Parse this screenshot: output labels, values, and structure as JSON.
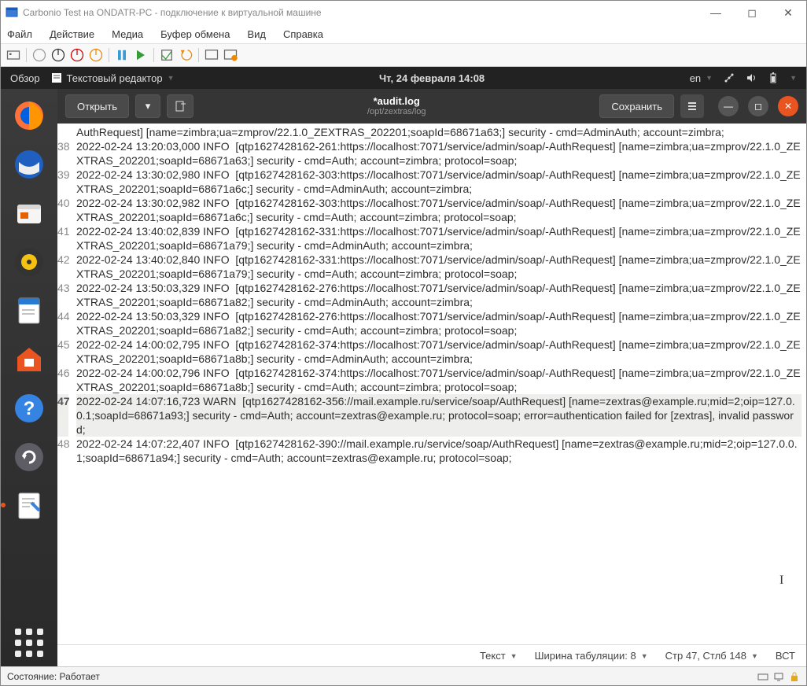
{
  "host": {
    "title": "Carbonio Test на ONDATR-PC - подключение к виртуальной машине",
    "menus": [
      "Файл",
      "Действие",
      "Медиа",
      "Буфер обмена",
      "Вид",
      "Справка"
    ],
    "status_left": "Состояние: Работает"
  },
  "guest_panel": {
    "activities": "Обзор",
    "app_indicator": "Текстовый редактор",
    "datetime": "Чт, 24 февраля  14:08",
    "lang": "en"
  },
  "editor": {
    "open_btn": "Открыть",
    "save_btn": "Сохранить",
    "filename": "*audit.log",
    "filepath": "/opt/zextras/log"
  },
  "statusbar": {
    "syntax": "Текст",
    "tab_label": "Ширина табуляции: 8",
    "cursor": "Стр 47, Стлб 148",
    "insert": "ВСТ"
  },
  "log": {
    "pre_lines": [
      "AuthRequest] [name=zimbra;ua=zmprov/22.1.0_ZEXTRAS_202201;soapId=68671a63;] security - cmd=AdminAuth; account=zimbra;"
    ],
    "entries": [
      {
        "n": 38,
        "hl": false,
        "t": "2022-02-24 13:20:03,000 INFO  [qtp1627428162-261:https://localhost:7071/service/admin/soap/-AuthRequest] [name=zimbra;ua=zmprov/22.1.0_ZEXTRAS_202201;soapId=68671a63;] security - cmd=Auth; account=zimbra; protocol=soap;"
      },
      {
        "n": 39,
        "hl": false,
        "t": "2022-02-24 13:30:02,980 INFO  [qtp1627428162-303:https://localhost:7071/service/admin/soap/-AuthRequest] [name=zimbra;ua=zmprov/22.1.0_ZEXTRAS_202201;soapId=68671a6c;] security - cmd=AdminAuth; account=zimbra;"
      },
      {
        "n": 40,
        "hl": false,
        "t": "2022-02-24 13:30:02,982 INFO  [qtp1627428162-303:https://localhost:7071/service/admin/soap/-AuthRequest] [name=zimbra;ua=zmprov/22.1.0_ZEXTRAS_202201;soapId=68671a6c;] security - cmd=Auth; account=zimbra; protocol=soap;"
      },
      {
        "n": 41,
        "hl": false,
        "t": "2022-02-24 13:40:02,839 INFO  [qtp1627428162-331:https://localhost:7071/service/admin/soap/-AuthRequest] [name=zimbra;ua=zmprov/22.1.0_ZEXTRAS_202201;soapId=68671a79;] security - cmd=AdminAuth; account=zimbra;"
      },
      {
        "n": 42,
        "hl": false,
        "t": "2022-02-24 13:40:02,840 INFO  [qtp1627428162-331:https://localhost:7071/service/admin/soap/-AuthRequest] [name=zimbra;ua=zmprov/22.1.0_ZEXTRAS_202201;soapId=68671a79;] security - cmd=Auth; account=zimbra; protocol=soap;"
      },
      {
        "n": 43,
        "hl": false,
        "t": "2022-02-24 13:50:03,329 INFO  [qtp1627428162-276:https://localhost:7071/service/admin/soap/-AuthRequest] [name=zimbra;ua=zmprov/22.1.0_ZEXTRAS_202201;soapId=68671a82;] security - cmd=AdminAuth; account=zimbra;"
      },
      {
        "n": 44,
        "hl": false,
        "t": "2022-02-24 13:50:03,329 INFO  [qtp1627428162-276:https://localhost:7071/service/admin/soap/-AuthRequest] [name=zimbra;ua=zmprov/22.1.0_ZEXTRAS_202201;soapId=68671a82;] security - cmd=Auth; account=zimbra; protocol=soap;"
      },
      {
        "n": 45,
        "hl": false,
        "t": "2022-02-24 14:00:02,795 INFO  [qtp1627428162-374:https://localhost:7071/service/admin/soap/-AuthRequest] [name=zimbra;ua=zmprov/22.1.0_ZEXTRAS_202201;soapId=68671a8b;] security - cmd=AdminAuth; account=zimbra;"
      },
      {
        "n": 46,
        "hl": false,
        "t": "2022-02-24 14:00:02,796 INFO  [qtp1627428162-374:https://localhost:7071/service/admin/soap/-AuthRequest] [name=zimbra;ua=zmprov/22.1.0_ZEXTRAS_202201;soapId=68671a8b;] security - cmd=Auth; account=zimbra; protocol=soap;"
      },
      {
        "n": 47,
        "hl": true,
        "t": "2022-02-24 14:07:16,723 WARN  [qtp1627428162-356://mail.example.ru/service/soap/AuthRequest] [name=zextras@example.ru;mid=2;oip=127.0.0.1;soapId=68671a93;] security - cmd=Auth; account=zextras@example.ru; protocol=soap; error=authentication failed for [zextras], invalid password;"
      },
      {
        "n": 48,
        "hl": false,
        "t": "2022-02-24 14:07:22,407 INFO  [qtp1627428162-390://mail.example.ru/service/soap/AuthRequest] [name=zextras@example.ru;mid=2;oip=127.0.0.1;soapId=68671a94;] security - cmd=Auth; account=zextras@example.ru; protocol=soap;"
      }
    ]
  }
}
